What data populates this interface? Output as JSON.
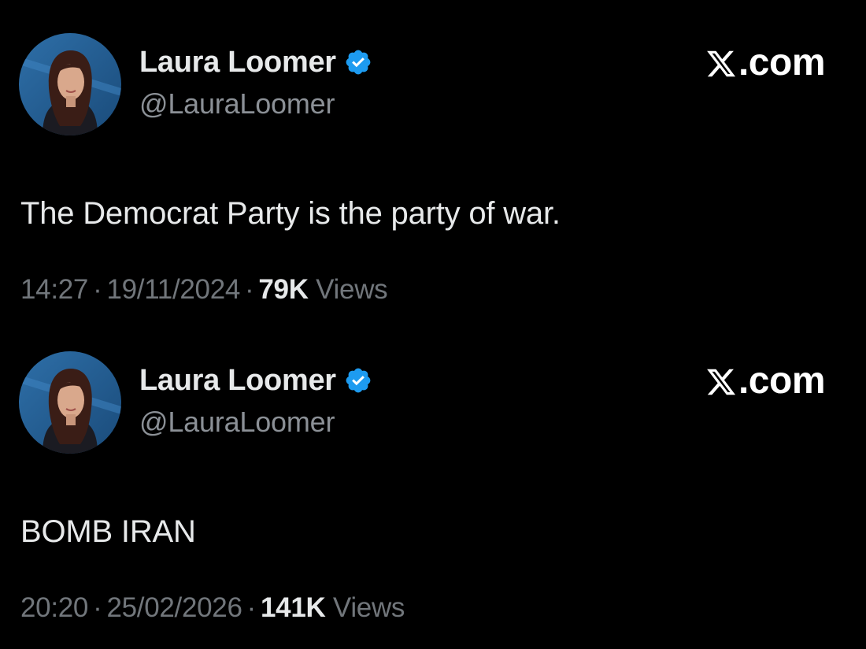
{
  "tweets": [
    {
      "author": {
        "display_name": "Laura Loomer",
        "handle": "@LauraLoomer",
        "verified_icon": "verified-badge-icon",
        "avatar": "profile-avatar"
      },
      "brand": ".com",
      "brand_icon": "x-logo-icon",
      "text": "The Democrat Party is the party of war.",
      "time": "14:27",
      "date": "19/11/2024",
      "separator": "·",
      "views_count": "79K",
      "views_label": "Views"
    },
    {
      "author": {
        "display_name": "Laura Loomer",
        "handle": "@LauraLoomer",
        "verified_icon": "verified-badge-icon",
        "avatar": "profile-avatar"
      },
      "brand": ".com",
      "brand_icon": "x-logo-icon",
      "text": "BOMB IRAN",
      "time": "20:20",
      "date": "25/02/2026",
      "separator": "·",
      "views_count": "141K",
      "views_label": "Views"
    }
  ],
  "colors": {
    "background": "#000000",
    "text_primary": "#e7e9ea",
    "text_secondary": "#71767b",
    "verified_blue": "#1d9bf0"
  }
}
